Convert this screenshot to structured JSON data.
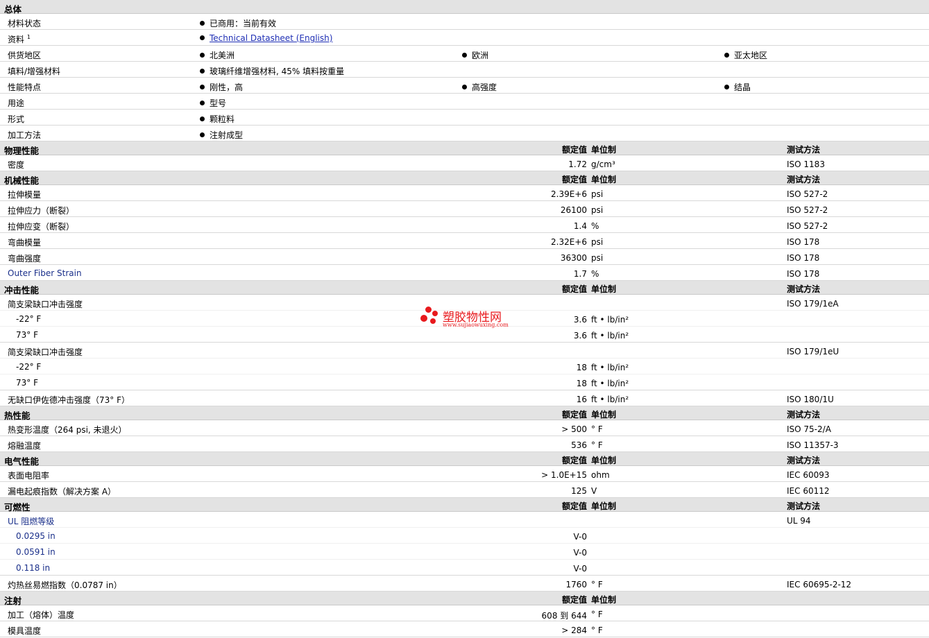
{
  "general": {
    "title": "总体",
    "rows": [
      {
        "label": "材料状态",
        "items": [
          "已商用：当前有效"
        ]
      },
      {
        "label": "资料",
        "sup": "1",
        "link": "Technical Datasheet (English)"
      },
      {
        "label": "供货地区",
        "items": [
          "北美洲",
          "欧洲",
          "亚太地区"
        ]
      },
      {
        "label": "填料/增强材料",
        "items": [
          "玻璃纤维增强材料, 45% 填料按重量"
        ]
      },
      {
        "label": "性能特点",
        "items": [
          "刚性，高",
          "高强度",
          "结晶"
        ]
      },
      {
        "label": "用途",
        "items": [
          "型号"
        ]
      },
      {
        "label": "形式",
        "items": [
          "颗粒料"
        ]
      },
      {
        "label": "加工方法",
        "items": [
          "注射成型"
        ]
      }
    ]
  },
  "sections": [
    {
      "title": "物理性能",
      "h_value": "额定值",
      "h_unit": "单位制",
      "h_method": "测试方法",
      "rows": [
        {
          "label": "密度",
          "value": "1.72",
          "unit": "g/cm³",
          "method": "ISO 1183"
        }
      ]
    },
    {
      "title": "机械性能",
      "h_value": "额定值",
      "h_unit": "单位制",
      "h_method": "测试方法",
      "rows": [
        {
          "label": "拉伸模量",
          "value": "2.39E+6",
          "unit": "psi",
          "method": "ISO 527-2"
        },
        {
          "label": "拉伸应力（断裂）",
          "value": "26100",
          "unit": "psi",
          "method": "ISO 527-2"
        },
        {
          "label": "拉伸应变（断裂）",
          "value": "1.4",
          "unit": "%",
          "method": "ISO 527-2"
        },
        {
          "label": "弯曲模量",
          "value": "2.32E+6",
          "unit": "psi",
          "method": "ISO 178"
        },
        {
          "label": "弯曲强度",
          "value": "36300",
          "unit": "psi",
          "method": "ISO 178"
        },
        {
          "label": "Outer Fiber Strain",
          "value": "1.7",
          "unit": "%",
          "method": "ISO 178",
          "blue": true
        }
      ]
    },
    {
      "title": "冲击性能",
      "h_value": "额定值",
      "h_unit": "单位制",
      "h_method": "测试方法",
      "rows": [
        {
          "label": "简支梁缺口冲击强度",
          "value": "",
          "unit": "",
          "method": "ISO 179/1eA",
          "nb": true
        },
        {
          "label": "-22° F",
          "value": "3.6",
          "unit": "ft • lb/in²",
          "method": "",
          "sub": true,
          "nb": true
        },
        {
          "label": "73° F",
          "value": "3.6",
          "unit": "ft • lb/in²",
          "method": "",
          "sub": true
        },
        {
          "label": "简支梁缺口冲击强度",
          "value": "",
          "unit": "",
          "method": "ISO 179/1eU",
          "nb": true
        },
        {
          "label": "-22° F",
          "value": "18",
          "unit": "ft • lb/in²",
          "method": "",
          "sub": true,
          "nb": true
        },
        {
          "label": "73° F",
          "value": "18",
          "unit": "ft • lb/in²",
          "method": "",
          "sub": true
        },
        {
          "label": "无缺口伊佐德冲击强度（73° F）",
          "value": "16",
          "unit": "ft • lb/in²",
          "method": "ISO 180/1U"
        }
      ]
    },
    {
      "title": "热性能",
      "h_value": "额定值",
      "h_unit": "单位制",
      "h_method": "测试方法",
      "rows": [
        {
          "label": "热变形温度（264 psi, 未退火）",
          "value": "> 500",
          "unit": "° F",
          "method": "ISO 75-2/A"
        },
        {
          "label": "熔融温度",
          "value": "536",
          "unit": "° F",
          "method": "ISO 11357-3"
        }
      ]
    },
    {
      "title": "电气性能",
      "h_value": "额定值",
      "h_unit": "单位制",
      "h_method": "测试方法",
      "rows": [
        {
          "label": "表面电阻率",
          "value": "> 1.0E+15",
          "unit": "ohm",
          "method": "IEC 60093"
        },
        {
          "label": "漏电起痕指数（解决方案 A）",
          "value": "125",
          "unit": "V",
          "method": "IEC 60112"
        }
      ]
    },
    {
      "title": "可燃性",
      "h_value": "额定值",
      "h_unit": "单位制",
      "h_method": "测试方法",
      "rows": [
        {
          "label": "UL 阻燃等级",
          "value": "",
          "unit": "",
          "method": "UL 94",
          "blue": true,
          "nb": true
        },
        {
          "label": "0.0295 in",
          "value": "V-0",
          "unit": "",
          "method": "",
          "sub": true,
          "blue": true,
          "nb": true
        },
        {
          "label": "0.0591 in",
          "value": "V-0",
          "unit": "",
          "method": "",
          "sub": true,
          "blue": true,
          "nb": true
        },
        {
          "label": "0.118 in",
          "value": "V-0",
          "unit": "",
          "method": "",
          "sub": true,
          "blue": true
        },
        {
          "label": "灼热丝易燃指数（0.0787 in）",
          "value": "1760",
          "unit": "° F",
          "method": "IEC 60695-2-12"
        }
      ]
    },
    {
      "title": "注射",
      "h_value": "额定值",
      "h_unit": "单位制",
      "h_method": "",
      "rows": [
        {
          "label": "加工（熔体）温度",
          "value": "608 到 644",
          "unit": "° F",
          "method": ""
        },
        {
          "label": "模具温度",
          "value": "> 284",
          "unit": "° F",
          "method": ""
        }
      ]
    }
  ],
  "watermark": {
    "title": "塑胶物性网",
    "url": "www.sujiaowuxing.com",
    "color": "#e8191d"
  }
}
